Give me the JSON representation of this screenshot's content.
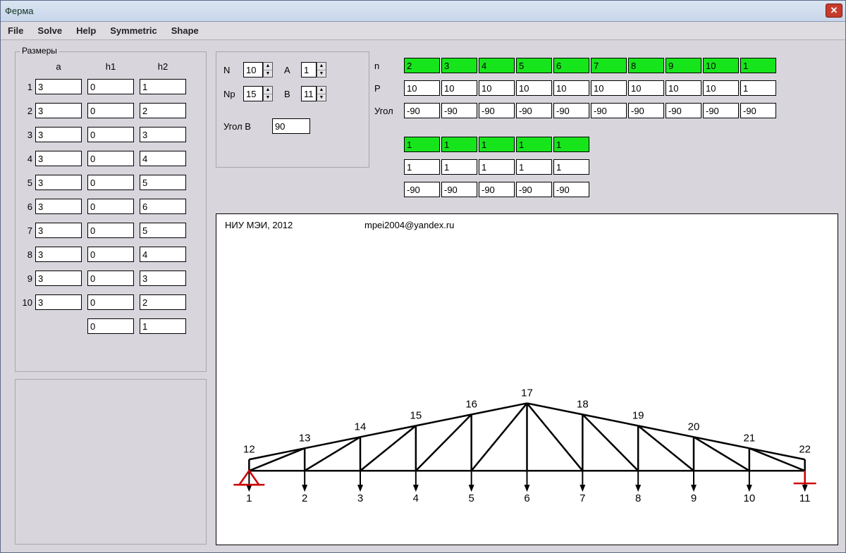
{
  "window": {
    "title": "Ферма"
  },
  "menu": {
    "file": "File",
    "solve": "Solve",
    "help": "Help",
    "symmetric": "Symmetric",
    "shape": "Shape"
  },
  "sizes": {
    "legend": "Размеры",
    "headers": {
      "a": "a",
      "h1": "h1",
      "h2": "h2"
    },
    "rows": [
      {
        "n": "1",
        "a": "3",
        "h1": "0",
        "h2": "1"
      },
      {
        "n": "2",
        "a": "3",
        "h1": "0",
        "h2": "2"
      },
      {
        "n": "3",
        "a": "3",
        "h1": "0",
        "h2": "3"
      },
      {
        "n": "4",
        "a": "3",
        "h1": "0",
        "h2": "4"
      },
      {
        "n": "5",
        "a": "3",
        "h1": "0",
        "h2": "5"
      },
      {
        "n": "6",
        "a": "3",
        "h1": "0",
        "h2": "6"
      },
      {
        "n": "7",
        "a": "3",
        "h1": "0",
        "h2": "5"
      },
      {
        "n": "8",
        "a": "3",
        "h1": "0",
        "h2": "4"
      },
      {
        "n": "9",
        "a": "3",
        "h1": "0",
        "h2": "3"
      },
      {
        "n": "10",
        "a": "3",
        "h1": "0",
        "h2": "2"
      },
      {
        "n": "",
        "a": "",
        "h1": "0",
        "h2": "1"
      }
    ]
  },
  "params": {
    "N_label": "N",
    "N": "10",
    "Np_label": "Np",
    "Np": "15",
    "A_label": "A",
    "A": "1",
    "B_label": "B",
    "B": "11",
    "angleB_label": "Угол B",
    "angleB": "90"
  },
  "loads": {
    "labels": {
      "n": "n",
      "P": "P",
      "ang": "Угол"
    },
    "row1": {
      "n": [
        "2",
        "3",
        "4",
        "5",
        "6",
        "7",
        "8",
        "9",
        "10",
        "1"
      ],
      "P": [
        "10",
        "10",
        "10",
        "10",
        "10",
        "10",
        "10",
        "10",
        "10",
        "1"
      ],
      "ang": [
        "-90",
        "-90",
        "-90",
        "-90",
        "-90",
        "-90",
        "-90",
        "-90",
        "-90",
        "-90"
      ]
    },
    "row2": {
      "n": [
        "1",
        "1",
        "1",
        "1",
        "1"
      ],
      "P": [
        "1",
        "1",
        "1",
        "1",
        "1"
      ],
      "ang": [
        "-90",
        "-90",
        "-90",
        "-90",
        "-90"
      ]
    }
  },
  "canvas": {
    "credit": "НИУ МЭИ, 2012",
    "email": "mpei2004@yandex.ru",
    "bottom_labels": [
      "1",
      "2",
      "3",
      "4",
      "5",
      "6",
      "7",
      "8",
      "9",
      "10",
      "11"
    ],
    "top_labels": [
      "12",
      "13",
      "14",
      "15",
      "16",
      "17",
      "18",
      "19",
      "20",
      "21",
      "22"
    ]
  }
}
